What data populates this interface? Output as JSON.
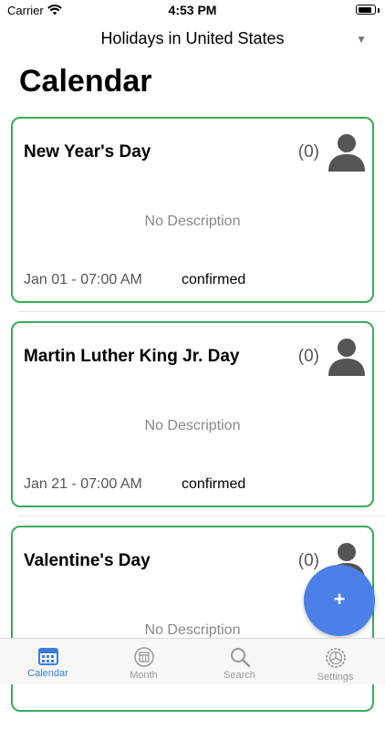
{
  "status_bar": {
    "carrier": "Carrier",
    "time": "4:53 PM"
  },
  "calendar_picker": {
    "label": "Holidays in United States"
  },
  "page": {
    "title": "Calendar"
  },
  "events": [
    {
      "title": "New Year's Day",
      "count": "(0)",
      "description": "No Description",
      "date": "Jan 01 - 07:00 AM",
      "status": "confirmed"
    },
    {
      "title": "Martin Luther King Jr. Day",
      "count": "(0)",
      "description": "No Description",
      "date": "Jan 21 - 07:00 AM",
      "status": "confirmed"
    },
    {
      "title": "Valentine's Day",
      "count": "(0)",
      "description": "No Description"
    }
  ],
  "fab": {
    "label": "+"
  },
  "tabs": [
    {
      "label": "Calendar",
      "icon": "calendar-icon",
      "active": true
    },
    {
      "label": "Month",
      "icon": "month-icon",
      "active": false
    },
    {
      "label": "Search",
      "icon": "search-icon",
      "active": false
    },
    {
      "label": "Settings",
      "icon": "settings-icon",
      "active": false
    }
  ],
  "colors": {
    "card_border": "#3aaa5b",
    "accent": "#3a7ee0",
    "fab": "#4a80e8",
    "inactive_tab": "#999999"
  }
}
